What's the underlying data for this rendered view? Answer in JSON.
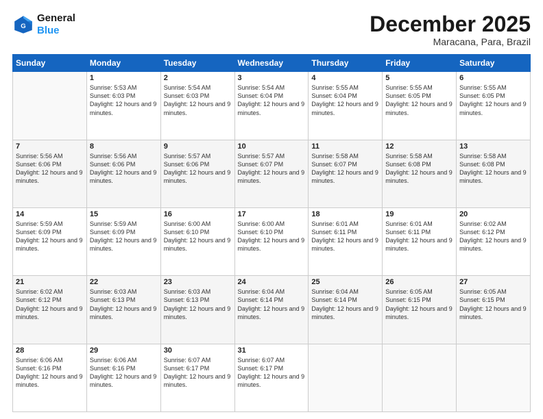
{
  "header": {
    "logo_line1": "General",
    "logo_line2": "Blue",
    "month_title": "December 2025",
    "location": "Maracana, Para, Brazil"
  },
  "weekdays": [
    "Sunday",
    "Monday",
    "Tuesday",
    "Wednesday",
    "Thursday",
    "Friday",
    "Saturday"
  ],
  "weeks": [
    [
      {
        "day": "",
        "sunrise": "",
        "sunset": "",
        "daylight": ""
      },
      {
        "day": "1",
        "sunrise": "Sunrise: 5:53 AM",
        "sunset": "Sunset: 6:03 PM",
        "daylight": "Daylight: 12 hours and 9 minutes."
      },
      {
        "day": "2",
        "sunrise": "Sunrise: 5:54 AM",
        "sunset": "Sunset: 6:03 PM",
        "daylight": "Daylight: 12 hours and 9 minutes."
      },
      {
        "day": "3",
        "sunrise": "Sunrise: 5:54 AM",
        "sunset": "Sunset: 6:04 PM",
        "daylight": "Daylight: 12 hours and 9 minutes."
      },
      {
        "day": "4",
        "sunrise": "Sunrise: 5:55 AM",
        "sunset": "Sunset: 6:04 PM",
        "daylight": "Daylight: 12 hours and 9 minutes."
      },
      {
        "day": "5",
        "sunrise": "Sunrise: 5:55 AM",
        "sunset": "Sunset: 6:05 PM",
        "daylight": "Daylight: 12 hours and 9 minutes."
      },
      {
        "day": "6",
        "sunrise": "Sunrise: 5:55 AM",
        "sunset": "Sunset: 6:05 PM",
        "daylight": "Daylight: 12 hours and 9 minutes."
      }
    ],
    [
      {
        "day": "7",
        "sunrise": "Sunrise: 5:56 AM",
        "sunset": "Sunset: 6:06 PM",
        "daylight": "Daylight: 12 hours and 9 minutes."
      },
      {
        "day": "8",
        "sunrise": "Sunrise: 5:56 AM",
        "sunset": "Sunset: 6:06 PM",
        "daylight": "Daylight: 12 hours and 9 minutes."
      },
      {
        "day": "9",
        "sunrise": "Sunrise: 5:57 AM",
        "sunset": "Sunset: 6:06 PM",
        "daylight": "Daylight: 12 hours and 9 minutes."
      },
      {
        "day": "10",
        "sunrise": "Sunrise: 5:57 AM",
        "sunset": "Sunset: 6:07 PM",
        "daylight": "Daylight: 12 hours and 9 minutes."
      },
      {
        "day": "11",
        "sunrise": "Sunrise: 5:58 AM",
        "sunset": "Sunset: 6:07 PM",
        "daylight": "Daylight: 12 hours and 9 minutes."
      },
      {
        "day": "12",
        "sunrise": "Sunrise: 5:58 AM",
        "sunset": "Sunset: 6:08 PM",
        "daylight": "Daylight: 12 hours and 9 minutes."
      },
      {
        "day": "13",
        "sunrise": "Sunrise: 5:58 AM",
        "sunset": "Sunset: 6:08 PM",
        "daylight": "Daylight: 12 hours and 9 minutes."
      }
    ],
    [
      {
        "day": "14",
        "sunrise": "Sunrise: 5:59 AM",
        "sunset": "Sunset: 6:09 PM",
        "daylight": "Daylight: 12 hours and 9 minutes."
      },
      {
        "day": "15",
        "sunrise": "Sunrise: 5:59 AM",
        "sunset": "Sunset: 6:09 PM",
        "daylight": "Daylight: 12 hours and 9 minutes."
      },
      {
        "day": "16",
        "sunrise": "Sunrise: 6:00 AM",
        "sunset": "Sunset: 6:10 PM",
        "daylight": "Daylight: 12 hours and 9 minutes."
      },
      {
        "day": "17",
        "sunrise": "Sunrise: 6:00 AM",
        "sunset": "Sunset: 6:10 PM",
        "daylight": "Daylight: 12 hours and 9 minutes."
      },
      {
        "day": "18",
        "sunrise": "Sunrise: 6:01 AM",
        "sunset": "Sunset: 6:11 PM",
        "daylight": "Daylight: 12 hours and 9 minutes."
      },
      {
        "day": "19",
        "sunrise": "Sunrise: 6:01 AM",
        "sunset": "Sunset: 6:11 PM",
        "daylight": "Daylight: 12 hours and 9 minutes."
      },
      {
        "day": "20",
        "sunrise": "Sunrise: 6:02 AM",
        "sunset": "Sunset: 6:12 PM",
        "daylight": "Daylight: 12 hours and 9 minutes."
      }
    ],
    [
      {
        "day": "21",
        "sunrise": "Sunrise: 6:02 AM",
        "sunset": "Sunset: 6:12 PM",
        "daylight": "Daylight: 12 hours and 9 minutes."
      },
      {
        "day": "22",
        "sunrise": "Sunrise: 6:03 AM",
        "sunset": "Sunset: 6:13 PM",
        "daylight": "Daylight: 12 hours and 9 minutes."
      },
      {
        "day": "23",
        "sunrise": "Sunrise: 6:03 AM",
        "sunset": "Sunset: 6:13 PM",
        "daylight": "Daylight: 12 hours and 9 minutes."
      },
      {
        "day": "24",
        "sunrise": "Sunrise: 6:04 AM",
        "sunset": "Sunset: 6:14 PM",
        "daylight": "Daylight: 12 hours and 9 minutes."
      },
      {
        "day": "25",
        "sunrise": "Sunrise: 6:04 AM",
        "sunset": "Sunset: 6:14 PM",
        "daylight": "Daylight: 12 hours and 9 minutes."
      },
      {
        "day": "26",
        "sunrise": "Sunrise: 6:05 AM",
        "sunset": "Sunset: 6:15 PM",
        "daylight": "Daylight: 12 hours and 9 minutes."
      },
      {
        "day": "27",
        "sunrise": "Sunrise: 6:05 AM",
        "sunset": "Sunset: 6:15 PM",
        "daylight": "Daylight: 12 hours and 9 minutes."
      }
    ],
    [
      {
        "day": "28",
        "sunrise": "Sunrise: 6:06 AM",
        "sunset": "Sunset: 6:16 PM",
        "daylight": "Daylight: 12 hours and 9 minutes."
      },
      {
        "day": "29",
        "sunrise": "Sunrise: 6:06 AM",
        "sunset": "Sunset: 6:16 PM",
        "daylight": "Daylight: 12 hours and 9 minutes."
      },
      {
        "day": "30",
        "sunrise": "Sunrise: 6:07 AM",
        "sunset": "Sunset: 6:17 PM",
        "daylight": "Daylight: 12 hours and 9 minutes."
      },
      {
        "day": "31",
        "sunrise": "Sunrise: 6:07 AM",
        "sunset": "Sunset: 6:17 PM",
        "daylight": "Daylight: 12 hours and 9 minutes."
      },
      {
        "day": "",
        "sunrise": "",
        "sunset": "",
        "daylight": ""
      },
      {
        "day": "",
        "sunrise": "",
        "sunset": "",
        "daylight": ""
      },
      {
        "day": "",
        "sunrise": "",
        "sunset": "",
        "daylight": ""
      }
    ]
  ]
}
